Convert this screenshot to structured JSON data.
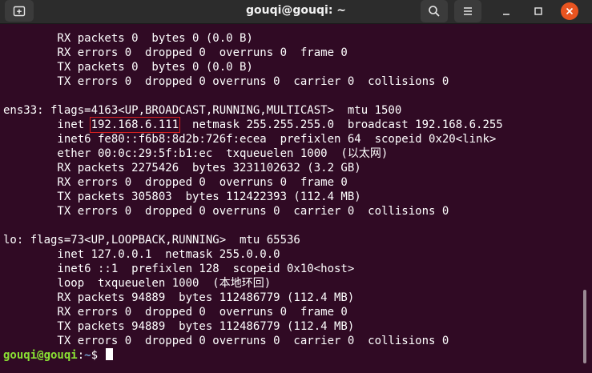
{
  "window": {
    "title": "gouqi@gouqi: ~",
    "icons": {
      "new_tab": "new-tab-icon",
      "search": "search-icon",
      "menu": "hamburger-menu-icon",
      "minimize": "minimize-icon",
      "maximize": "maximize-icon",
      "close": "close-icon"
    },
    "colors": {
      "terminal_bg": "#300a24",
      "titlebar_bg": "#2c2c2c",
      "close_accent": "#e95420",
      "prompt_user": "#8ae234",
      "prompt_path": "#729fcf",
      "highlight_box": "#d62020"
    }
  },
  "terminal": {
    "lines": [
      "        RX packets 0  bytes 0 (0.0 B)",
      "        RX errors 0  dropped 0  overruns 0  frame 0",
      "        TX packets 0  bytes 0 (0.0 B)",
      "        TX errors 0  dropped 0 overruns 0  carrier 0  collisions 0",
      "",
      "ens33: flags=4163<UP,BROADCAST,RUNNING,MULTICAST>  mtu 1500"
    ],
    "inet_prefix": "        inet ",
    "inet_highlight": "192.168.6.111",
    "inet_suffix": "  netmask 255.255.255.0  broadcast 192.168.6.255",
    "lines2": [
      "        inet6 fe80::f6b8:8d2b:726f:ecea  prefixlen 64  scopeid 0x20<link>",
      "        ether 00:0c:29:5f:b1:ec  txqueuelen 1000  (以太网)",
      "        RX packets 2275426  bytes 3231102632 (3.2 GB)",
      "        RX errors 0  dropped 0  overruns 0  frame 0",
      "        TX packets 305803  bytes 112422393 (112.4 MB)",
      "        TX errors 0  dropped 0 overruns 0  carrier 0  collisions 0",
      "",
      "lo: flags=73<UP,LOOPBACK,RUNNING>  mtu 65536",
      "        inet 127.0.0.1  netmask 255.0.0.0",
      "        inet6 ::1  prefixlen 128  scopeid 0x10<host>",
      "        loop  txqueuelen 1000  (本地环回)",
      "        RX packets 94889  bytes 112486779 (112.4 MB)",
      "        RX errors 0  dropped 0  overruns 0  frame 0",
      "        TX packets 94889  bytes 112486779 (112.4 MB)",
      "        TX errors 0  dropped 0 overruns 0  carrier 0  collisions 0"
    ],
    "prompt": {
      "user_host": "gouqi@gouqi",
      "separator": ":",
      "path": "~",
      "symbol": "$ "
    }
  }
}
